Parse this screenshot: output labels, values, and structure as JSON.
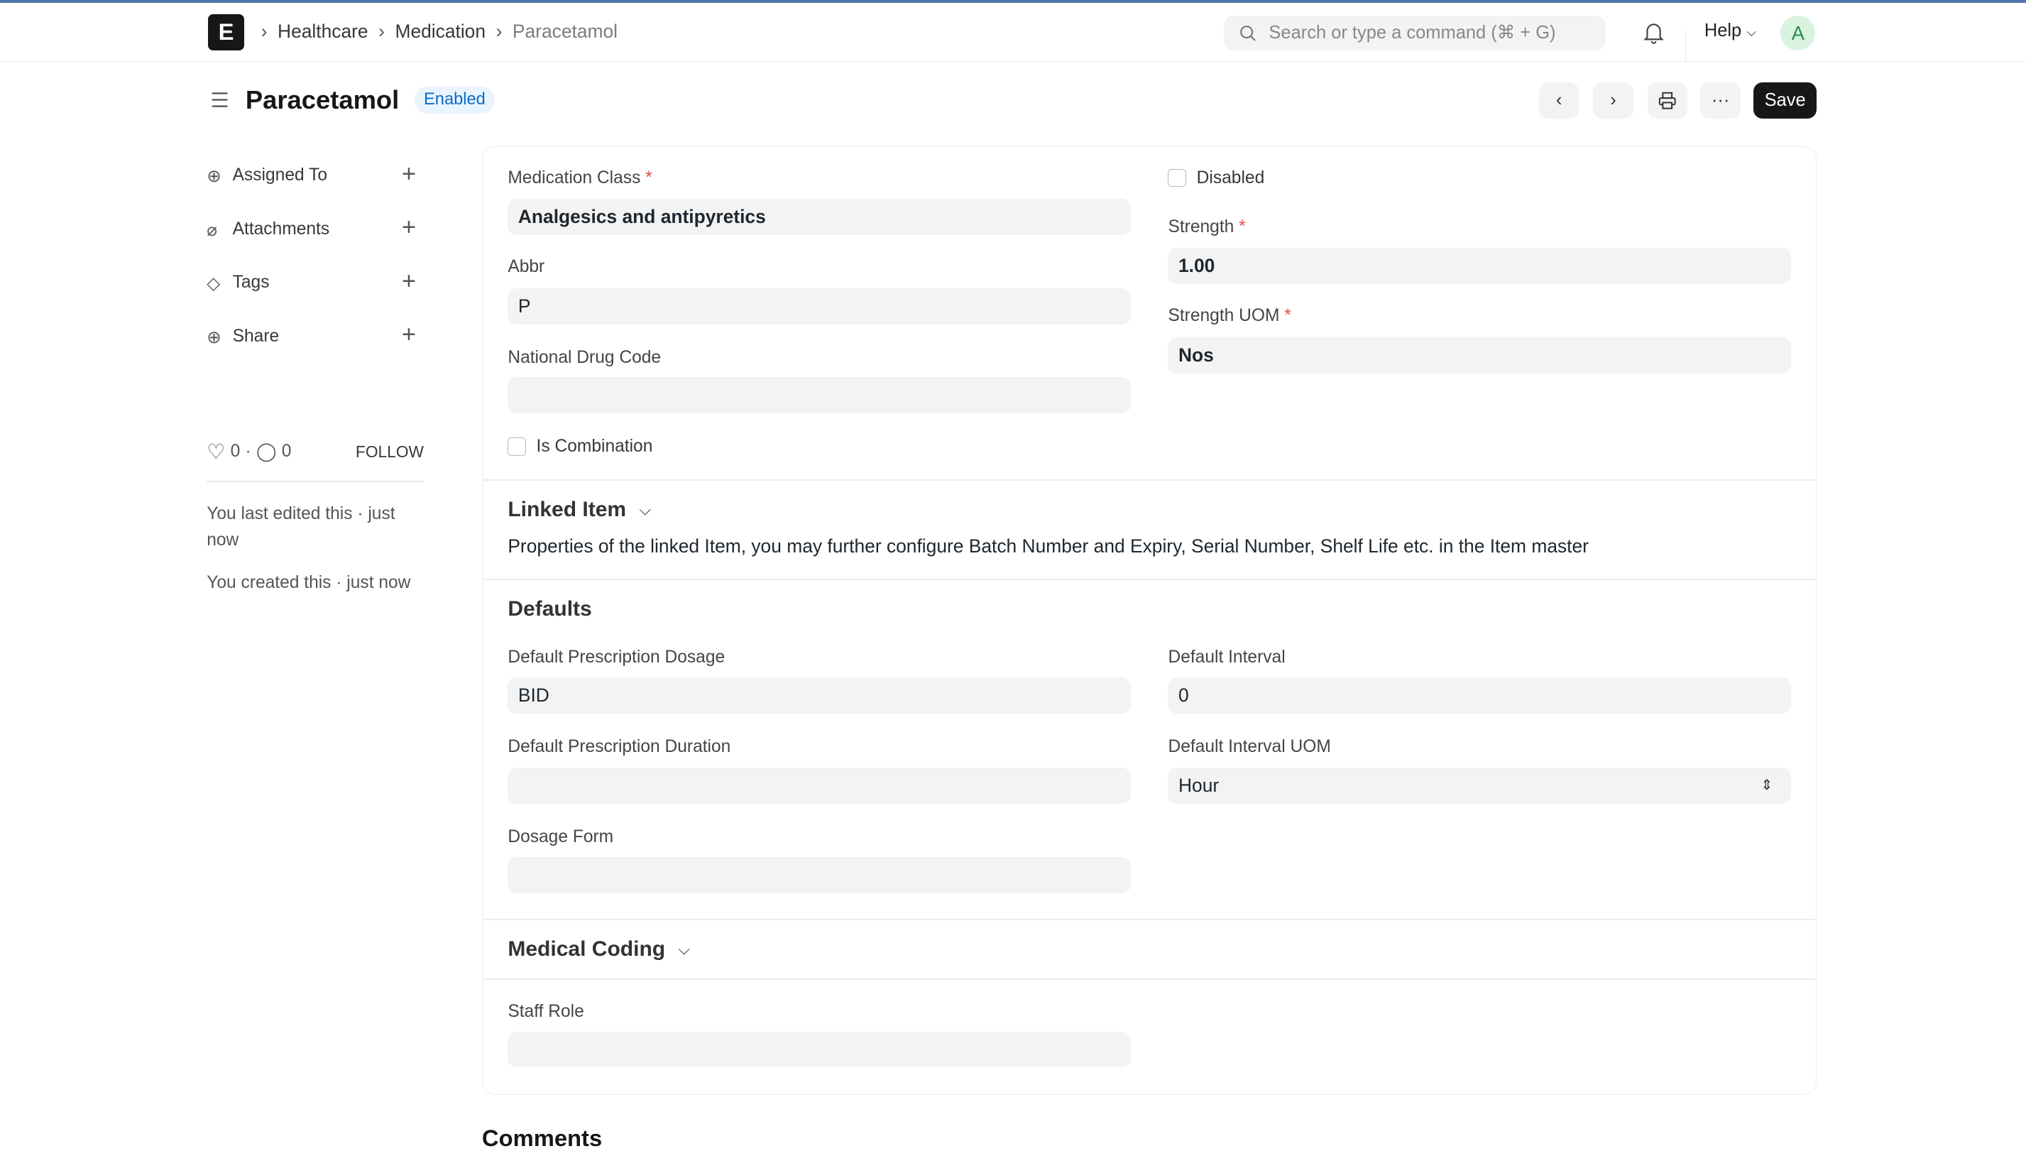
{
  "navbar": {
    "logo": "E",
    "breadcrumbs": [
      "Healthcare",
      "Medication",
      "Paracetamol"
    ],
    "search_placeholder": "Search or type a command (⌘ + G)",
    "help": "Help",
    "avatar": "A"
  },
  "header": {
    "title": "Paracetamol",
    "status": "Enabled",
    "save": "Save",
    "more": "···"
  },
  "sidebar": {
    "items": [
      {
        "label": "Assigned To",
        "icon": "user-plus-icon"
      },
      {
        "label": "Attachments",
        "icon": "paperclip-icon"
      },
      {
        "label": "Tags",
        "icon": "tag-icon"
      },
      {
        "label": "Share",
        "icon": "share-icon"
      }
    ],
    "likes": "0",
    "comments": "0",
    "follow": "FOLLOW",
    "last_edited": "You last edited this · just now",
    "created": "You created this · just now"
  },
  "form": {
    "medication_class": {
      "label": "Medication Class",
      "value": "Analgesics and antipyretics"
    },
    "abbr": {
      "label": "Abbr",
      "value": "P"
    },
    "ndc": {
      "label": "National Drug Code",
      "value": ""
    },
    "is_combination": {
      "label": "Is Combination",
      "checked": false
    },
    "disabled": {
      "label": "Disabled",
      "checked": false
    },
    "strength": {
      "label": "Strength",
      "value": "1.00"
    },
    "strength_uom": {
      "label": "Strength UOM",
      "value": "Nos"
    },
    "linked_item": {
      "title": "Linked Item",
      "description": "Properties of the linked Item, you may further configure Batch Number and Expiry, Serial Number, Shelf Life etc. in the Item master"
    },
    "defaults": {
      "title": "Defaults",
      "dosage": {
        "label": "Default Prescription Dosage",
        "value": "BID"
      },
      "duration": {
        "label": "Default Prescription Duration",
        "value": ""
      },
      "dosage_form": {
        "label": "Dosage Form",
        "value": ""
      },
      "interval": {
        "label": "Default Interval",
        "value": "0"
      },
      "interval_uom": {
        "label": "Default Interval UOM",
        "value": "Hour"
      }
    },
    "medical_coding": {
      "title": "Medical Coding"
    },
    "staff_role": {
      "label": "Staff Role",
      "value": ""
    }
  },
  "comments_title": "Comments"
}
